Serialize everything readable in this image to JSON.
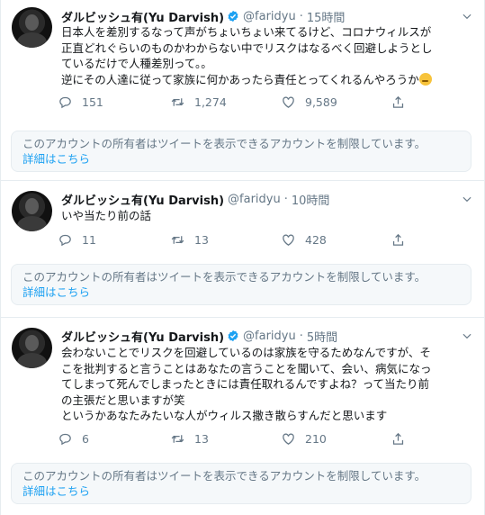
{
  "tweets": [
    {
      "name": "ダルビッシュ有(Yu Darvish)",
      "handle": "@faridyu",
      "time": "15時間",
      "lines": [
        "日本人を差別するなって声がちょいちょい来てるけど、コロナウィルスが",
        "正直どれぐらいのものかわからない中でリスクはなるべく回避しようとし",
        "ているだけで人種差別って。。",
        "逆にその人達に従って家族に何かあったら責任とってくれるんやろうか"
      ],
      "emoji": "thinking-face",
      "replies": "151",
      "retweets": "1,274",
      "likes": "9,589"
    },
    {
      "name": "ダルビッシュ有(Yu Darvish)",
      "handle": "@faridyu",
      "time": "10時間",
      "lines": [
        "いや当たり前の話"
      ],
      "replies": "11",
      "retweets": "13",
      "likes": "428"
    },
    {
      "name": "ダルビッシュ有(Yu Darvish)",
      "handle": "@faridyu",
      "time": "5時間",
      "lines": [
        "会わないことでリスクを回避しているのは家族を守るためなんですが、そ",
        "こを批判すると言うことはあなたの言うことを聞いて、会い、病気になっ",
        "てしまって死んでしまったときには責任取れるんですよね？って当たり前",
        "の主張だと思いますが笑",
        "というかあなたみたいな人がウィルス撒き散らすんだと思います"
      ],
      "replies": "6",
      "retweets": "13",
      "likes": "210"
    }
  ],
  "notice": {
    "text": "このアカウントの所有者はツイートを表示できるアカウントを制限しています。",
    "link": "詳細はこちら"
  },
  "colors": {
    "secondary": "#657786",
    "link": "#1da1f2",
    "verified": "#1da1f2",
    "notice_bg": "#f5f8fa"
  }
}
